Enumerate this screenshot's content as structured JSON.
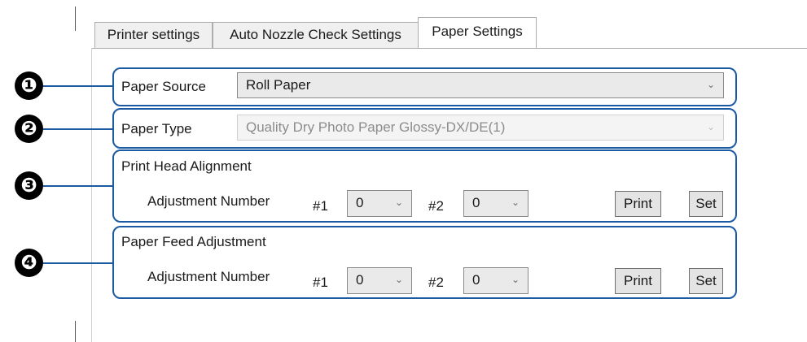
{
  "tabs": [
    {
      "label": "Printer settings"
    },
    {
      "label": "Auto Nozzle Check Settings"
    },
    {
      "label": "Paper Settings"
    }
  ],
  "paper_source": {
    "label": "Paper Source",
    "value": "Roll Paper"
  },
  "paper_type": {
    "label": "Paper Type",
    "value": "Quality Dry Photo Paper Glossy-DX/DE(1)"
  },
  "print_head_alignment": {
    "title": "Print Head Alignment",
    "adjustment_label": "Adjustment Number",
    "hash1": "#1",
    "value1": "0",
    "hash2": "#2",
    "value2": "0",
    "print_label": "Print",
    "set_label": "Set"
  },
  "paper_feed_adjustment": {
    "title": "Paper Feed Adjustment",
    "adjustment_label": "Adjustment Number",
    "hash1": "#1",
    "value1": "0",
    "hash2": "#2",
    "value2": "0",
    "print_label": "Print",
    "set_label": "Set"
  },
  "callouts": [
    "❶",
    "❷",
    "❸",
    "❹"
  ],
  "colors": {
    "callout_border": "#1b5aa3",
    "badge": "#000000"
  },
  "icons": {
    "dropdown": "chevron-down-icon"
  }
}
